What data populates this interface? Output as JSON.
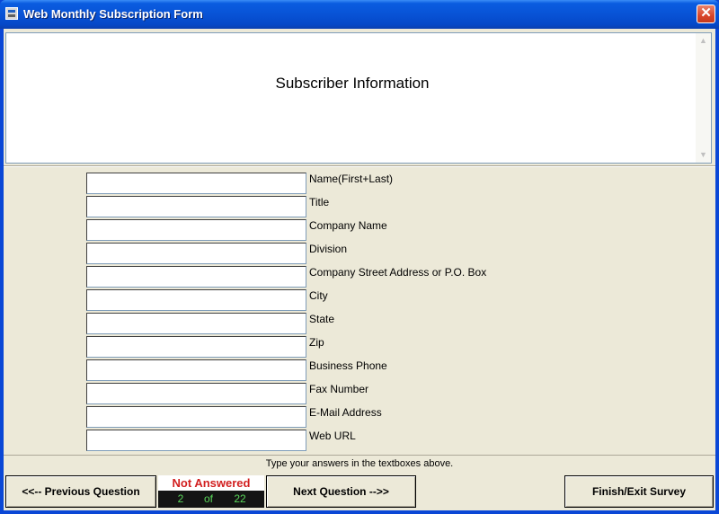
{
  "window": {
    "title": "Web Monthly Subscription Form",
    "close_glyph": "✕"
  },
  "question": {
    "title": "Subscriber Information"
  },
  "fields": [
    {
      "label": "Name(First+Last)",
      "value": ""
    },
    {
      "label": "Title",
      "value": ""
    },
    {
      "label": "Company Name",
      "value": ""
    },
    {
      "label": "Division",
      "value": ""
    },
    {
      "label": "Company Street Address or P.O. Box",
      "value": ""
    },
    {
      "label": "City",
      "value": ""
    },
    {
      "label": "State",
      "value": ""
    },
    {
      "label": "Zip",
      "value": ""
    },
    {
      "label": "Business Phone",
      "value": ""
    },
    {
      "label": "Fax Number",
      "value": ""
    },
    {
      "label": "E-Mail Address",
      "value": ""
    },
    {
      "label": "Web URL",
      "value": ""
    }
  ],
  "instructions": "Type your answers in the textboxes above.",
  "nav": {
    "prev_label": "<<-- Previous Question",
    "next_label": "Next Question -->>",
    "finish_label": "Finish/Exit Survey"
  },
  "status": {
    "state": "Not Answered",
    "current": "2",
    "of_label": "of",
    "total": "22"
  },
  "colors": {
    "title_bar": "#0853d6",
    "status_text": "#d21f1f",
    "counter_text": "#5ad65a",
    "window_bg": "#ece9d8"
  },
  "icons": {
    "app": "form-app-icon",
    "close": "close-icon",
    "scroll_up": "scroll-up-arrow-icon",
    "scroll_down": "scroll-down-arrow-icon"
  }
}
